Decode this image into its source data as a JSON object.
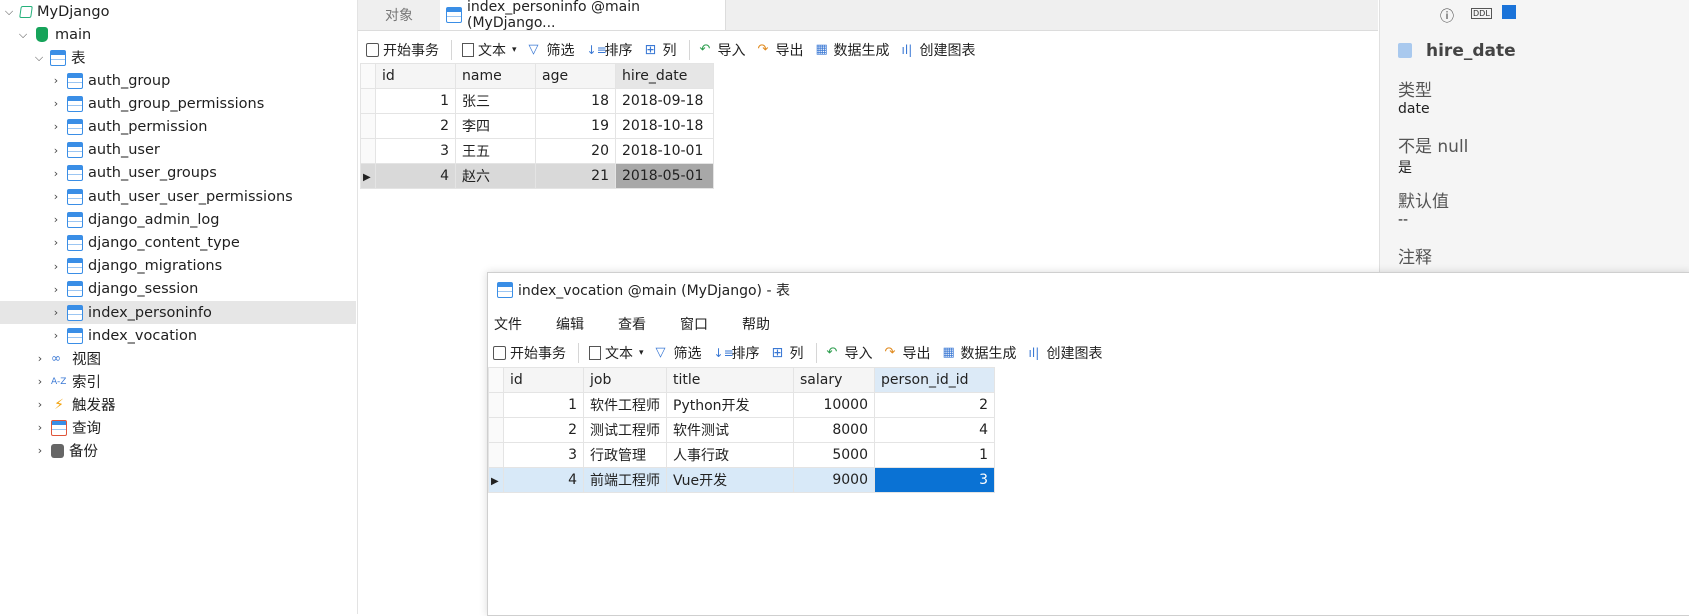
{
  "sidebar": {
    "connection": "MyDjango",
    "database": "main",
    "tables_group": "表",
    "tables": [
      "auth_group",
      "auth_group_permissions",
      "auth_permission",
      "auth_user",
      "auth_user_groups",
      "auth_user_user_permissions",
      "django_admin_log",
      "django_content_type",
      "django_migrations",
      "django_session",
      "index_personinfo",
      "index_vocation"
    ],
    "other_groups": [
      "视图",
      "索引",
      "触发器",
      "查询",
      "备份"
    ]
  },
  "tabs": {
    "objects": "对象",
    "active": "index_personinfo @main (MyDjango..."
  },
  "toolbar": {
    "begin_tx": "开始事务",
    "text": "文本",
    "filter": "筛选",
    "sort": "排序",
    "columns": "列",
    "import": "导入",
    "export": "导出",
    "datagen": "数据生成",
    "chart": "创建图表"
  },
  "personinfo": {
    "headers": [
      "id",
      "name",
      "age",
      "hire_date"
    ],
    "rows": [
      [
        "1",
        "张三",
        "18",
        "2018-09-18"
      ],
      [
        "2",
        "李四",
        "19",
        "2018-10-18"
      ],
      [
        "3",
        "王五",
        "20",
        "2018-10-01"
      ],
      [
        "4",
        "赵六",
        "21",
        "2018-05-01"
      ]
    ]
  },
  "rightpanel": {
    "field_name": "hire_date",
    "type_label": "类型",
    "type_value": "date",
    "notnull_label": "不是 null",
    "notnull_value": "是",
    "default_label": "默认值",
    "default_value": "--",
    "comment_label": "注释"
  },
  "vocation_window": {
    "title": "index_vocation @main (MyDjango) - 表",
    "menu": [
      "文件",
      "编辑",
      "查看",
      "窗口",
      "帮助"
    ],
    "headers": [
      "id",
      "job",
      "title",
      "salary",
      "person_id_id"
    ],
    "rows": [
      [
        "1",
        "软件工程师",
        "Python开发",
        "10000",
        "2"
      ],
      [
        "2",
        "测试工程师",
        "软件测试",
        "8000",
        "4"
      ],
      [
        "3",
        "行政管理",
        "人事行政",
        "5000",
        "1"
      ],
      [
        "4",
        "前端工程师",
        "Vue开发",
        "9000",
        "3"
      ]
    ]
  }
}
